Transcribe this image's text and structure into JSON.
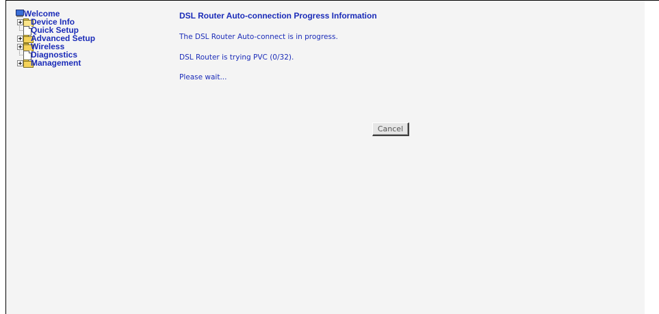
{
  "sidebar": {
    "root": {
      "label": "Welcome",
      "icon": "computer-icon"
    },
    "items": [
      {
        "label": "Device Info",
        "expandable": true,
        "icon": "folder-open-icon"
      },
      {
        "label": "Quick Setup",
        "expandable": false,
        "icon": "page-icon"
      },
      {
        "label": "Advanced Setup",
        "expandable": true,
        "icon": "folder-icon"
      },
      {
        "label": "Wireless",
        "expandable": true,
        "icon": "folder-icon"
      },
      {
        "label": "Diagnostics",
        "expandable": false,
        "icon": "page-icon"
      },
      {
        "label": "Management",
        "expandable": true,
        "icon": "folder-icon"
      }
    ]
  },
  "main": {
    "title": "DSL Router Auto-connection Progress Information",
    "status_line": "The DSL Router Auto-connect is in progress.",
    "trying_line": "DSL Router is trying PVC (0/32).",
    "wait_line": "Please wait...",
    "cancel_label": "Cancel"
  },
  "colors": {
    "link_blue": "#1a2bb8",
    "content_background": "#f4f4f4"
  }
}
